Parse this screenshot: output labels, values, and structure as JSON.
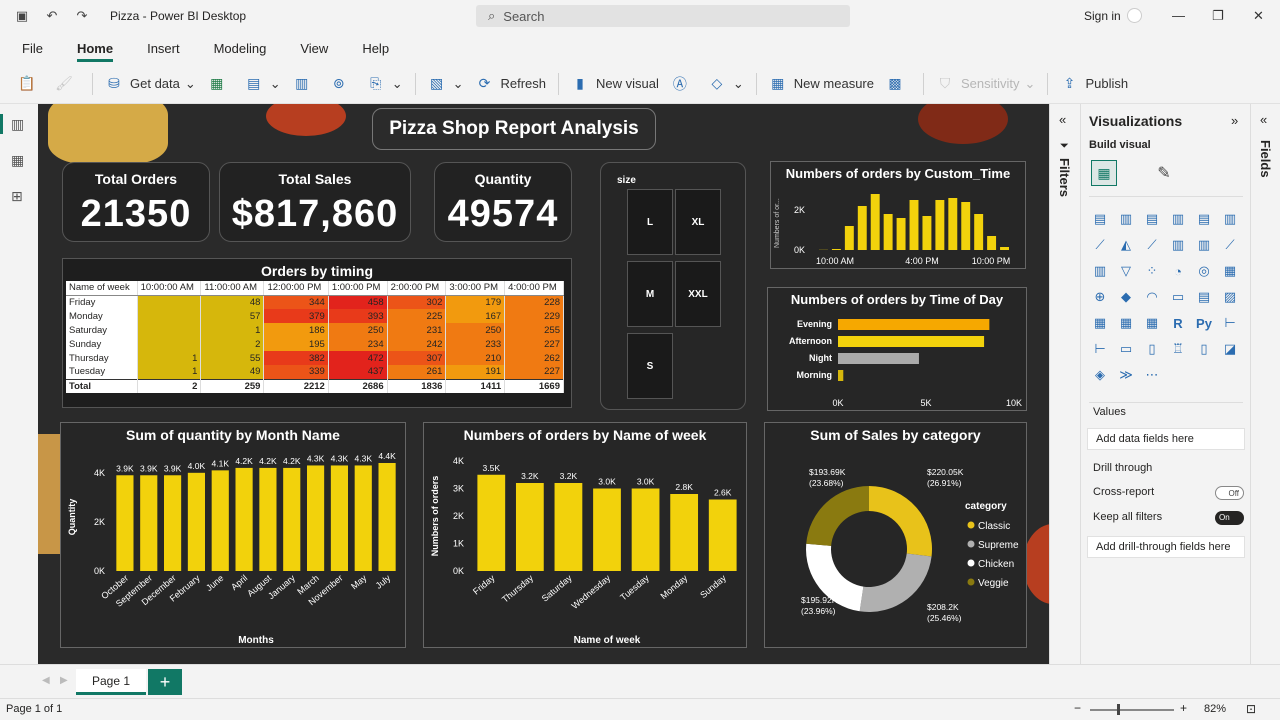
{
  "window": {
    "title": "Pizza - Power BI Desktop",
    "search_placeholder": "Search",
    "sign_in": "Sign in"
  },
  "menu": [
    "File",
    "Home",
    "Insert",
    "Modeling",
    "View",
    "Help"
  ],
  "ribbon": {
    "get_data": "Get data",
    "refresh": "Refresh",
    "new_visual": "New visual",
    "new_measure": "New measure",
    "sensitivity": "Sensitivity",
    "publish": "Publish"
  },
  "report": {
    "title": "Pizza Shop Report Analysis",
    "cards": [
      {
        "label": "Total Orders",
        "value": "21350"
      },
      {
        "label": "Total Sales",
        "value": "$817,860"
      },
      {
        "label": "Quantity",
        "value": "49574"
      }
    ],
    "slicer": {
      "title": "size",
      "options": [
        "L",
        "XL",
        "M",
        "XXL",
        "S"
      ]
    },
    "matrix": {
      "title": "Orders by timing",
      "corner": "Name of week",
      "columns": [
        "10:00:00 AM",
        "11:00:00 AM",
        "12:00:00 PM",
        "1:00:00 PM",
        "2:00:00 PM",
        "3:00:00 PM",
        "4:00:00 PM"
      ],
      "rows": [
        {
          "name": "Friday",
          "values": [
            "",
            "48",
            "344",
            "458",
            "302",
            "179",
            "228"
          ]
        },
        {
          "name": "Monday",
          "values": [
            "",
            "57",
            "379",
            "393",
            "225",
            "167",
            "229"
          ]
        },
        {
          "name": "Saturday",
          "values": [
            "",
            "1",
            "186",
            "250",
            "231",
            "250",
            "255"
          ]
        },
        {
          "name": "Sunday",
          "values": [
            "",
            "2",
            "195",
            "234",
            "242",
            "233",
            "227"
          ]
        },
        {
          "name": "Thursday",
          "values": [
            "1",
            "55",
            "382",
            "472",
            "307",
            "210",
            "262"
          ]
        },
        {
          "name": "Tuesday",
          "values": [
            "1",
            "49",
            "339",
            "437",
            "261",
            "191",
            "227"
          ]
        }
      ],
      "total": {
        "name": "Total",
        "values": [
          "2",
          "259",
          "2212",
          "2686",
          "1836",
          "1411",
          "1669"
        ]
      }
    }
  },
  "chart_data": [
    {
      "type": "bar",
      "title": "Numbers of orders by Custom_Time",
      "ylabel": "Numbers of or...",
      "xticks": [
        "10:00 AM",
        "4:00 PM",
        "10:00 PM"
      ],
      "yticks": [
        "0K",
        "2K"
      ],
      "ylim": [
        0,
        3000
      ],
      "values": [
        10,
        50,
        1200,
        2200,
        2800,
        1800,
        1600,
        2500,
        1700,
        2500,
        2600,
        2400,
        1800,
        700,
        150
      ]
    },
    {
      "type": "bar",
      "orientation": "horizontal",
      "title": "Numbers of orders by Time of Day",
      "categories": [
        "Evening",
        "Afternoon",
        "Night",
        "Morning"
      ],
      "values": [
        8600,
        8300,
        4600,
        300
      ],
      "colors": [
        "#f6a800",
        "#f2d20c",
        "#aaaaaa",
        "#d6b70c"
      ],
      "xticks": [
        "0K",
        "5K",
        "10K"
      ],
      "xlim": [
        0,
        10000
      ]
    },
    {
      "type": "bar",
      "title": "Sum of quantity by Month Name",
      "xlabel": "Months",
      "ylabel": "Quantity",
      "categories": [
        "October",
        "September",
        "December",
        "February",
        "June",
        "April",
        "August",
        "January",
        "March",
        "November",
        "May",
        "July"
      ],
      "labels": [
        "3.9K",
        "3.9K",
        "3.9K",
        "4.0K",
        "4.1K",
        "4.2K",
        "4.2K",
        "4.2K",
        "4.3K",
        "4.3K",
        "4.3K",
        "4.4K"
      ],
      "values": [
        3900,
        3900,
        3900,
        4000,
        4100,
        4200,
        4200,
        4200,
        4300,
        4300,
        4300,
        4400
      ],
      "yticks": [
        "0K",
        "2K",
        "4K"
      ],
      "ylim": [
        0,
        4000
      ]
    },
    {
      "type": "bar",
      "title": "Numbers of orders by Name of week",
      "xlabel": "Name of week",
      "ylabel": "Numbers of orders",
      "categories": [
        "Friday",
        "Thursday",
        "Saturday",
        "Wednesday",
        "Tuesday",
        "Monday",
        "Sunday"
      ],
      "labels": [
        "3.5K",
        "3.2K",
        "3.2K",
        "3.0K",
        "3.0K",
        "2.8K",
        "2.6K"
      ],
      "values": [
        3500,
        3200,
        3200,
        3000,
        3000,
        2800,
        2600
      ],
      "yticks": [
        "0K",
        "1K",
        "2K",
        "3K",
        "4K"
      ],
      "ylim": [
        0,
        4000
      ]
    },
    {
      "type": "pie",
      "title": "Sum of Sales by category",
      "legend_title": "category",
      "categories": [
        "Classic",
        "Supreme",
        "Chicken",
        "Veggie"
      ],
      "values": [
        220.05,
        208.2,
        195.92,
        193.69
      ],
      "labels": [
        "$220.05K\n(26.91%)",
        "$208.2K\n(25.46%)",
        "$195.92K\n(23.96%)",
        "$193.69K\n(23.68%)"
      ],
      "colors": [
        "#e8c21a",
        "#b0b0b0",
        "#ffffff",
        "#8a7a10"
      ]
    }
  ],
  "visualizations": {
    "title": "Visualizations",
    "build": "Build visual",
    "values": "Values",
    "add_fields": "Add data fields here",
    "drill": "Drill through",
    "cross": "Cross-report",
    "cross_state": "Off",
    "keep": "Keep all filters",
    "keep_state": "On",
    "add_drill": "Add drill-through fields here"
  },
  "side": {
    "filters": "Filters",
    "fields": "Fields"
  },
  "pages": {
    "tab": "Page 1",
    "add": "+",
    "status": "Page 1 of 1",
    "zoom": "82%"
  }
}
